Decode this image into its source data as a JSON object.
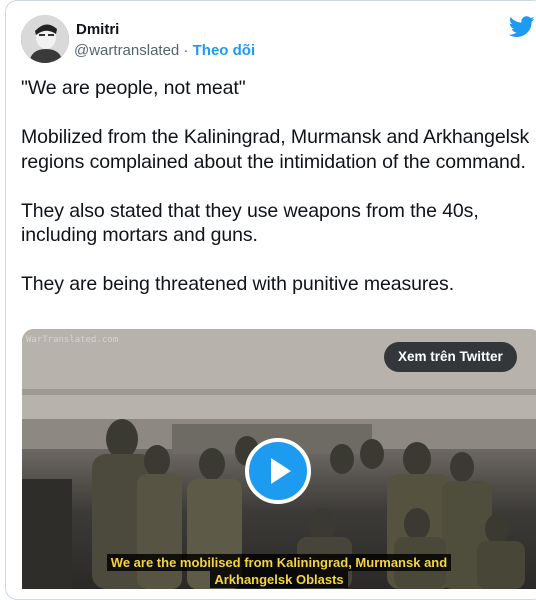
{
  "author": {
    "name": "Dmitri",
    "handle": "@wartranslated",
    "separator": "·",
    "follow_label": "Theo dõi"
  },
  "tweet": {
    "text": "\"We are people, not meat\"\n\nMobilized from the Kaliningrad, Murmansk and Arkhangelsk regions complained about the intimidation of the command.\n\nThey also stated that they use weapons from the 40s, including mortars and guns.\n\nThey are being threatened with punitive measures."
  },
  "video": {
    "watermark": "WarTranslated.com",
    "watch_on_twitter_label": "Xem trên Twitter",
    "subtitle": "We are the mobilised from Kaliningrad, Murmansk and Arkhangelsk Oblasts"
  },
  "icons": {
    "brand": "twitter-bird-icon",
    "play": "play-icon"
  },
  "colors": {
    "brand": "#1d9bf0",
    "text": "#0f1419",
    "secondary": "#536471",
    "subtitle": "#f5d53b"
  }
}
